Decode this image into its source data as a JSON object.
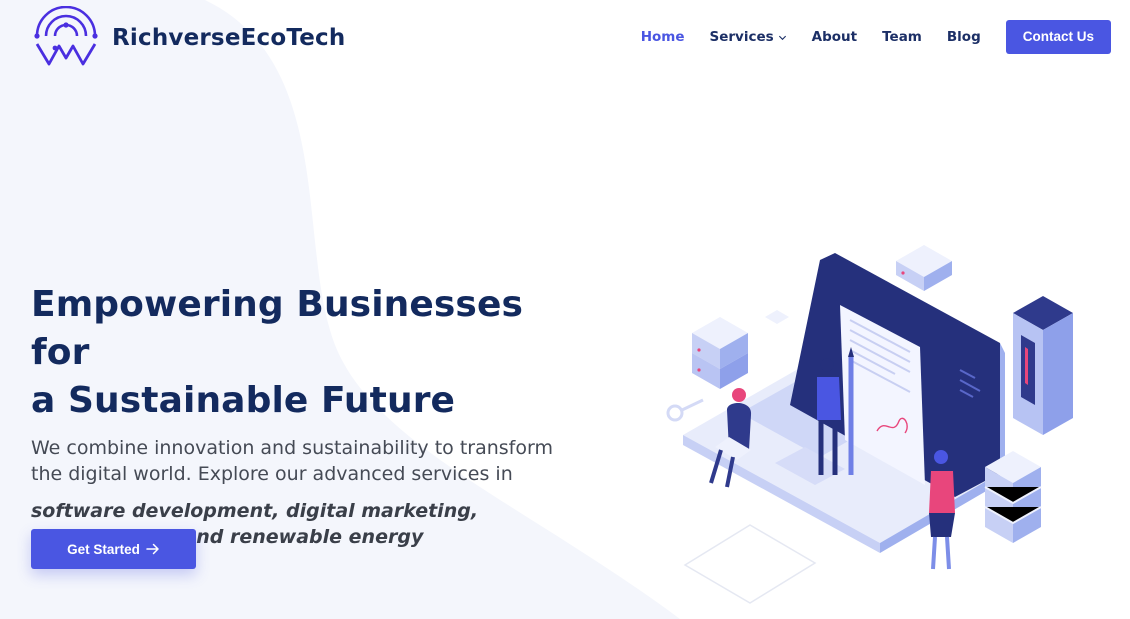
{
  "brand": {
    "name": "RichverseEcoTech"
  },
  "nav": {
    "items": [
      {
        "label": "Home",
        "active": true
      },
      {
        "label": "Services",
        "dropdown": true
      },
      {
        "label": "About"
      },
      {
        "label": "Team"
      },
      {
        "label": "Blog"
      }
    ],
    "contact_label": "Contact Us"
  },
  "hero": {
    "title_line1": "Empowering Businesses for",
    "title_line2": "a Sustainable Future",
    "desc_line1": "We combine innovation and sustainability to transform",
    "desc_line2": "the digital world. Explore our advanced services in",
    "services_line1": "software development, digital marketing,",
    "services_line2": "cybersecurity and renewable energy",
    "cta_label": "Get Started"
  },
  "colors": {
    "accent": "#4a56e2",
    "heading": "#132a5e",
    "nav_text": "#1c2f66",
    "body_text": "#454a55",
    "background_shape": "#f4f6fc"
  },
  "icons": {
    "logo": "wifi-signal-w-logo",
    "services_dropdown": "chevron-down-icon",
    "cta_arrow": "arrow-right-icon"
  }
}
